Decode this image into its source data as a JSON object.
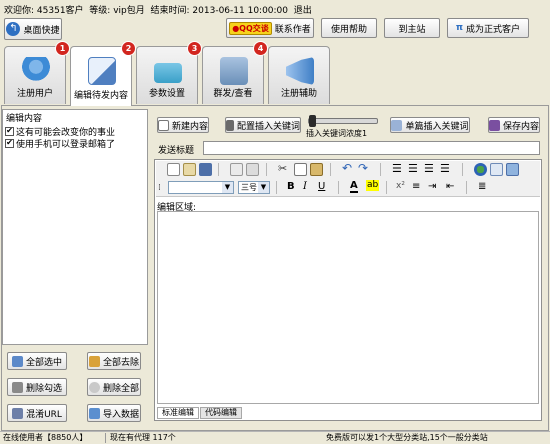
{
  "header": {
    "welcome_label": "欢迎你:",
    "user_id": "45351客户",
    "level_label": "等级:",
    "level_value": "vip包月",
    "end_time_label": "结束时间:",
    "end_time_value": "2013-06-11 10:00:00",
    "logout_label": "退出"
  },
  "toolbar": {
    "desktop_shortcut": "桌面快捷",
    "qq_chat": "QQ交谈",
    "contact_author": "联系作者",
    "help": "使用帮助",
    "home_site": "到主站",
    "become_customer": "成为正式客户"
  },
  "tabs": [
    {
      "label": "注册用户",
      "badge": "1",
      "icon": "user-icon",
      "color": "#3d8bd6"
    },
    {
      "label": "编辑待发内容",
      "badge": "2",
      "icon": "edit-icon",
      "color": "#4f7fc0"
    },
    {
      "label": "参数设置",
      "badge": "3",
      "icon": "toolbox-icon",
      "color": "#3aa0c8"
    },
    {
      "label": "群发/查看",
      "badge": "4",
      "icon": "broadcast-icon",
      "color": "#6a8fb8"
    },
    {
      "label": "注册辅助",
      "badge": "",
      "icon": "megaphone-icon",
      "color": "#3f7fc6"
    }
  ],
  "left_panel": {
    "title": "编辑内容",
    "items": [
      {
        "label": "这有可能会改变你的事业",
        "checked": true
      },
      {
        "label": "使用手机可以登录邮箱了",
        "checked": true
      }
    ],
    "buttons": {
      "select_all": "全部选中",
      "remove_all": "全部去除",
      "delete_checked": "删除勾选",
      "delete_all": "删除全部",
      "clean_url": "混淆URL",
      "import_data": "导入数据"
    }
  },
  "editor": {
    "new_content": "新建内容",
    "config_keywords": "配置插入关键词",
    "insert_density": "插入关键词浓度1",
    "single_keyword": "单篇插入关键词",
    "save_content": "保存内容",
    "send_title_label": "发送标题",
    "send_title_value": "",
    "font_size_value": "三号",
    "edit_area_label": "编辑区域:",
    "tab_standard": "标准编辑",
    "tab_code": "代码编辑"
  },
  "status_bar": {
    "online_users": "在线使用者【8850人】",
    "current_agents": "现在有代理 117个",
    "free_notice": "免费版可以发1个大型分类站,15个一般分类站"
  },
  "colors": {
    "background": "#ECE9D8",
    "badge": "#d2261f",
    "accent": "#3d6fb0"
  }
}
